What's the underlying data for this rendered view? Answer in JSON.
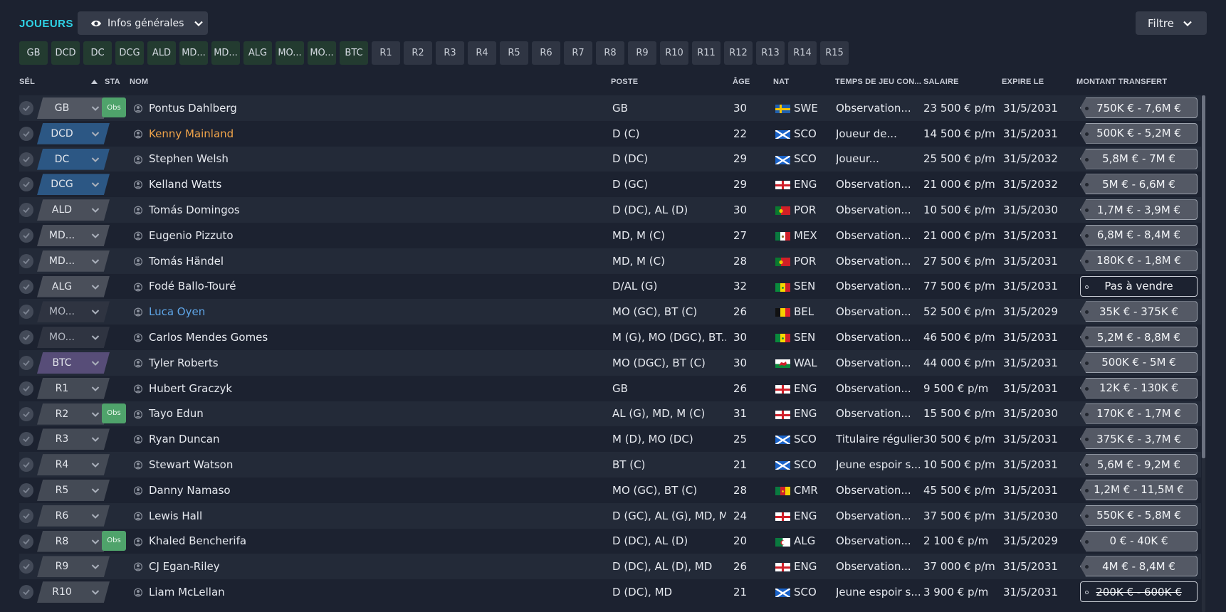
{
  "header": {
    "title": "JOUEURS",
    "view_label": "Infos générales",
    "filter_label": "Filtre"
  },
  "chips": [
    {
      "label": "GB",
      "filled": true
    },
    {
      "label": "DCD",
      "filled": true
    },
    {
      "label": "DC",
      "filled": true
    },
    {
      "label": "DCG",
      "filled": true
    },
    {
      "label": "ALD",
      "filled": true
    },
    {
      "label": "MD...",
      "filled": true
    },
    {
      "label": "MD...",
      "filled": true
    },
    {
      "label": "ALG",
      "filled": true
    },
    {
      "label": "MO...",
      "filled": true
    },
    {
      "label": "MO...",
      "filled": true
    },
    {
      "label": "BTC",
      "filled": true
    },
    {
      "label": "R1",
      "filled": false
    },
    {
      "label": "R2",
      "filled": false
    },
    {
      "label": "R3",
      "filled": false
    },
    {
      "label": "R4",
      "filled": false
    },
    {
      "label": "R5",
      "filled": false
    },
    {
      "label": "R6",
      "filled": false
    },
    {
      "label": "R7",
      "filled": false
    },
    {
      "label": "R8",
      "filled": false
    },
    {
      "label": "R9",
      "filled": false
    },
    {
      "label": "R10",
      "filled": false
    },
    {
      "label": "R11",
      "filled": false
    },
    {
      "label": "R12",
      "filled": false
    },
    {
      "label": "R13",
      "filled": false
    },
    {
      "label": "R14",
      "filled": false
    },
    {
      "label": "R15",
      "filled": false
    }
  ],
  "columns": {
    "sel": "SÉL",
    "sta": "STA",
    "nom": "NOM",
    "poste": "POSTE",
    "age": "ÂGE",
    "nat": "NAT",
    "temps": "TEMPS DE JEU CON...",
    "salaire": "SALAIRE",
    "expire": "EXPIRE LE",
    "montant": "MONTANT TRANSFERT"
  },
  "players": [
    {
      "role": "GB",
      "role_type": "gk",
      "obs": true,
      "name": "Pontus Dahlberg",
      "name_color": "",
      "pos": "GB",
      "age": "30",
      "flag": "swe",
      "nat": "SWE",
      "play": "Observation...",
      "salary": "23 500 € p/m",
      "expires": "31/5/2031",
      "fee": "750K € - 7,6M €",
      "fee_style": "normal"
    },
    {
      "role": "DCD",
      "role_type": "def",
      "obs": false,
      "name": "Kenny Mainland",
      "name_color": "orange",
      "pos": "D (C)",
      "age": "22",
      "flag": "sco",
      "nat": "SCO",
      "play": "Joueur de...",
      "salary": "14 500 € p/m",
      "expires": "31/5/2031",
      "fee": "500K € - 5,2M €",
      "fee_style": "normal"
    },
    {
      "role": "DC",
      "role_type": "def",
      "obs": false,
      "name": "Stephen Welsh",
      "name_color": "",
      "pos": "D (DC)",
      "age": "29",
      "flag": "sco",
      "nat": "SCO",
      "play": "Joueur...",
      "salary": "25 500 € p/m",
      "expires": "31/5/2032",
      "fee": "5,8M € - 7M €",
      "fee_style": "normal"
    },
    {
      "role": "DCG",
      "role_type": "def",
      "obs": false,
      "name": "Kelland Watts",
      "name_color": "",
      "pos": "D (GC)",
      "age": "29",
      "flag": "eng",
      "nat": "ENG",
      "play": "Observation...",
      "salary": "21 000 € p/m",
      "expires": "31/5/2032",
      "fee": "5M € - 6,6M €",
      "fee_style": "normal"
    },
    {
      "role": "ALD",
      "role_type": "mid",
      "obs": false,
      "name": "Tomás Domingos",
      "name_color": "",
      "pos": "D (DC), AL (D)",
      "age": "30",
      "flag": "por",
      "nat": "POR",
      "play": "Observation...",
      "salary": "10 500 € p/m",
      "expires": "31/5/2030",
      "fee": "1,7M € - 3,9M €",
      "fee_style": "normal"
    },
    {
      "role": "MD...",
      "role_type": "mid",
      "obs": false,
      "name": "Eugenio Pizzuto",
      "name_color": "",
      "pos": "MD, M (C)",
      "age": "27",
      "flag": "mex",
      "nat": "MEX",
      "play": "Observation...",
      "salary": "21 000 € p/m",
      "expires": "31/5/2031",
      "fee": "6,8M € - 8,4M €",
      "fee_style": "normal"
    },
    {
      "role": "MD...",
      "role_type": "mid",
      "obs": false,
      "name": "Tomás Händel",
      "name_color": "",
      "pos": "MD, M (C)",
      "age": "28",
      "flag": "por",
      "nat": "POR",
      "play": "Observation...",
      "salary": "27 500 € p/m",
      "expires": "31/5/2031",
      "fee": "180K € - 1,8M €",
      "fee_style": "normal"
    },
    {
      "role": "ALG",
      "role_type": "mid",
      "obs": false,
      "name": "Fodé Ballo-Touré",
      "name_color": "",
      "pos": "D/AL (G)",
      "age": "32",
      "flag": "sen",
      "nat": "SEN",
      "play": "Observation...",
      "salary": "77 500 € p/m",
      "expires": "31/5/2031",
      "fee": "Pas à vendre",
      "fee_style": "nosale"
    },
    {
      "role": "MO...",
      "role_type": "dim",
      "obs": false,
      "name": "Luca Oyen",
      "name_color": "blue",
      "pos": "MO (GC), BT (C)",
      "age": "26",
      "flag": "bel",
      "nat": "BEL",
      "play": "Observation...",
      "salary": "52 500 € p/m",
      "expires": "31/5/2029",
      "fee": "35K € - 375K €",
      "fee_style": "normal"
    },
    {
      "role": "MO...",
      "role_type": "dim",
      "obs": false,
      "name": "Carlos Mendes Gomes",
      "name_color": "",
      "pos": "M (G), MO (DGC), BT...",
      "age": "30",
      "flag": "sen",
      "nat": "SEN",
      "play": "Observation...",
      "salary": "46 500 € p/m",
      "expires": "31/5/2031",
      "fee": "5,2M € - 8,8M €",
      "fee_style": "normal"
    },
    {
      "role": "BTC",
      "role_type": "fwd",
      "obs": false,
      "name": "Tyler Roberts",
      "name_color": "",
      "pos": "MO (DGC), BT (C)",
      "age": "30",
      "flag": "wal",
      "nat": "WAL",
      "play": "Observation...",
      "salary": "44 000 € p/m",
      "expires": "31/5/2031",
      "fee": "500K € - 5M €",
      "fee_style": "normal"
    },
    {
      "role": "R1",
      "role_type": "sub",
      "obs": false,
      "name": "Hubert Graczyk",
      "name_color": "",
      "pos": "GB",
      "age": "26",
      "flag": "eng",
      "nat": "ENG",
      "play": "Observation...",
      "salary": "9 500 € p/m",
      "expires": "31/5/2031",
      "fee": "12K € - 130K €",
      "fee_style": "normal"
    },
    {
      "role": "R2",
      "role_type": "sub",
      "obs": true,
      "name": "Tayo Edun",
      "name_color": "",
      "pos": "AL (G), MD, M (C)",
      "age": "31",
      "flag": "eng",
      "nat": "ENG",
      "play": "Observation...",
      "salary": "15 500 € p/m",
      "expires": "31/5/2030",
      "fee": "170K € - 1,7M €",
      "fee_style": "normal"
    },
    {
      "role": "R3",
      "role_type": "sub",
      "obs": false,
      "name": "Ryan Duncan",
      "name_color": "",
      "pos": "M (D), MO (DC)",
      "age": "25",
      "flag": "sco",
      "nat": "SCO",
      "play": "Titulaire régulier",
      "salary": "30 500 € p/m",
      "expires": "31/5/2031",
      "fee": "375K € - 3,7M €",
      "fee_style": "normal"
    },
    {
      "role": "R4",
      "role_type": "sub",
      "obs": false,
      "name": "Stewart Watson",
      "name_color": "",
      "pos": "BT (C)",
      "age": "21",
      "flag": "sco",
      "nat": "SCO",
      "play": "Jeune espoir s...",
      "salary": "10 500 € p/m",
      "expires": "31/5/2031",
      "fee": "5,6M € - 9,2M €",
      "fee_style": "normal"
    },
    {
      "role": "R5",
      "role_type": "sub",
      "obs": false,
      "name": "Danny Namaso",
      "name_color": "",
      "pos": "MO (GC), BT (C)",
      "age": "28",
      "flag": "cmr",
      "nat": "CMR",
      "play": "Observation...",
      "salary": "45 500 € p/m",
      "expires": "31/5/2031",
      "fee": "1,2M € - 11,5M €",
      "fee_style": "normal"
    },
    {
      "role": "R6",
      "role_type": "sub",
      "obs": false,
      "name": "Lewis Hall",
      "name_color": "",
      "pos": "D (GC), AL (G), MD, M...",
      "age": "24",
      "flag": "eng",
      "nat": "ENG",
      "play": "Observation...",
      "salary": "37 500 € p/m",
      "expires": "31/5/2030",
      "fee": "550K € - 5,8M €",
      "fee_style": "normal"
    },
    {
      "role": "R8",
      "role_type": "sub",
      "obs": true,
      "name": "Khaled Bencherifa",
      "name_color": "",
      "pos": "D (DC), AL (D)",
      "age": "20",
      "flag": "alg",
      "nat": "ALG",
      "play": "Observation...",
      "salary": "2 100 € p/m",
      "expires": "31/5/2029",
      "fee": "0 € - 40K €",
      "fee_style": "normal"
    },
    {
      "role": "R9",
      "role_type": "sub",
      "obs": false,
      "name": "CJ Egan-Riley",
      "name_color": "",
      "pos": "D (DC), AL (D), MD",
      "age": "26",
      "flag": "eng",
      "nat": "ENG",
      "play": "Observation...",
      "salary": "37 000 € p/m",
      "expires": "31/5/2031",
      "fee": "4M € - 8,4M €",
      "fee_style": "normal"
    },
    {
      "role": "R10",
      "role_type": "sub",
      "obs": false,
      "name": "Liam McLellan",
      "name_color": "",
      "pos": "D (DC), MD",
      "age": "21",
      "flag": "sco",
      "nat": "SCO",
      "play": "Jeune espoir s...",
      "salary": "3 900 € p/m",
      "expires": "31/5/2031",
      "fee": "200K € - 600K €",
      "fee_style": "strike"
    }
  ]
}
